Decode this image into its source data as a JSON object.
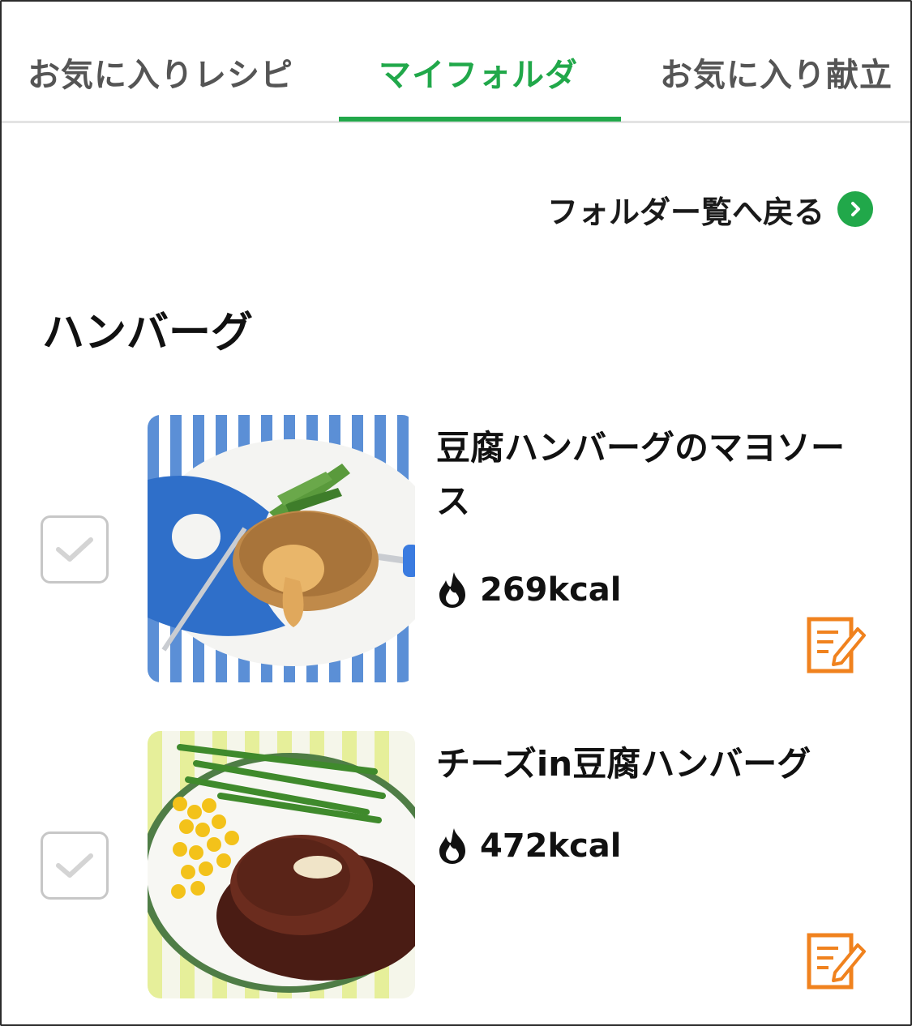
{
  "tabs": {
    "favorite_recipes": "お気に入りレシピ",
    "my_folder": "マイフォルダ",
    "favorite_menus": "お気に入り献立"
  },
  "back_link": {
    "label": "フォルダー覧へ戻る",
    "icon": "chevron-right-circle-icon"
  },
  "folder": {
    "title": "ハンバーグ"
  },
  "recipes": [
    {
      "title": "豆腐ハンバーグのマヨソース",
      "calories": "269kcal",
      "checked": false
    },
    {
      "title": "チーズin豆腐ハンバーグ",
      "calories": "472kcal",
      "checked": false
    }
  ],
  "colors": {
    "accent": "#21a84a",
    "memo_icon": "#f0821e",
    "tab_text": "#555555"
  }
}
